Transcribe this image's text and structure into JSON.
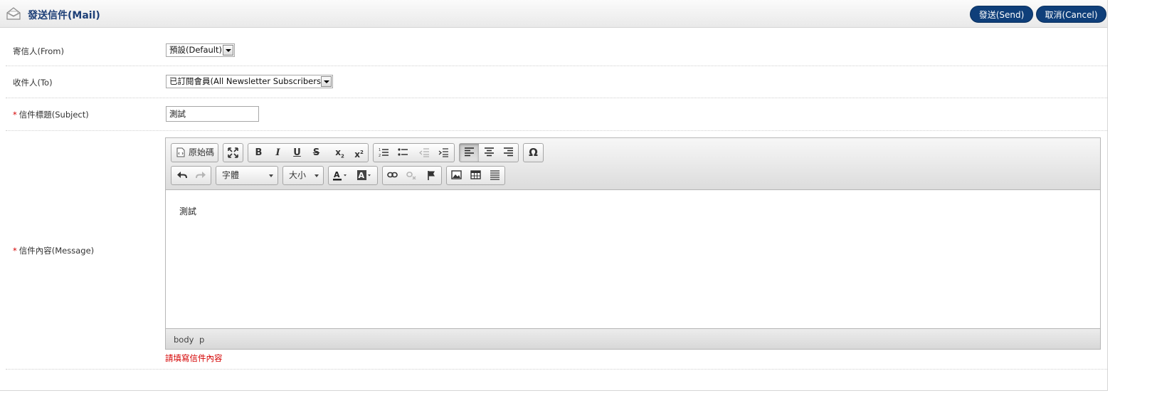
{
  "header": {
    "title": "發送信件(Mail)",
    "send_label": "發送(Send)",
    "cancel_label": "取消(Cancel)"
  },
  "form": {
    "from": {
      "label": "寄信人(From)",
      "value": "預設(Default)"
    },
    "to": {
      "label": "收件人(To)",
      "value": "已訂閱會員(All Newsletter Subscribers)"
    },
    "subject": {
      "required_mark": "*",
      "label": "信件標題(Subject)",
      "value": "測試"
    },
    "message": {
      "required_mark": "*",
      "label": "信件內容(Message)",
      "content": "測試",
      "error": "請填寫信件內容"
    }
  },
  "editor": {
    "source_label": "原始碼",
    "font_combo": "字體",
    "size_combo": "大小",
    "path": [
      "body",
      "p"
    ],
    "active_button": "align-left"
  },
  "colors": {
    "header_title": "#1d3f77",
    "button_bg": "#0f3f7a",
    "required": "#d40000"
  }
}
